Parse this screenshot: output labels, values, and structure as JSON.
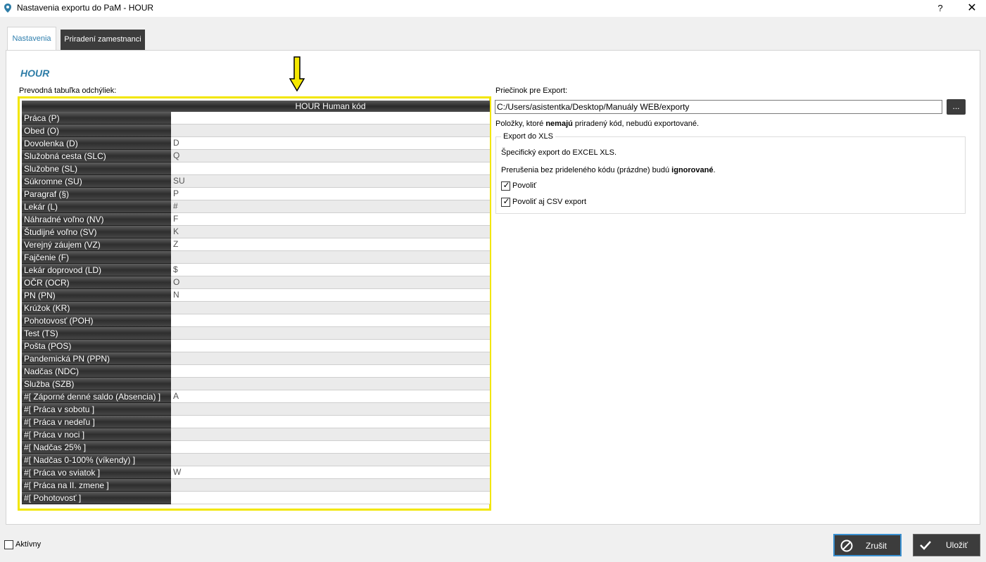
{
  "window": {
    "title": "Nastavenia exportu do PaM - HOUR",
    "help": "?",
    "close": "✕"
  },
  "tabs": [
    {
      "label": "Nastavenia",
      "active": true
    },
    {
      "label": "Priradení zamestnanci",
      "active": false
    }
  ],
  "section_title": "HOUR",
  "table": {
    "label": "Prevodná tabuľka odchýliek:",
    "column_header": "HOUR Human kód",
    "rows": [
      {
        "name": "Práca  (P)",
        "code": ""
      },
      {
        "name": "Obed  (O)",
        "code": ""
      },
      {
        "name": "Dovolenka  (D)",
        "code": "D"
      },
      {
        "name": "Služobná cesta  (SLC)",
        "code": "Q"
      },
      {
        "name": "Služobne  (SL)",
        "code": ""
      },
      {
        "name": "Súkromne  (SU)",
        "code": "SU"
      },
      {
        "name": "Paragraf  (§)",
        "code": "P"
      },
      {
        "name": "Lekár  (L)",
        "code": "#"
      },
      {
        "name": "Náhradné voľno  (NV)",
        "code": "F"
      },
      {
        "name": "Študijné voľno  (SV)",
        "code": "K"
      },
      {
        "name": "Verejný záujem  (VZ)",
        "code": "Z"
      },
      {
        "name": "Fajčenie  (F)",
        "code": ""
      },
      {
        "name": "Lekár doprovod  (LD)",
        "code": "$"
      },
      {
        "name": "OČR  (OCR)",
        "code": "O"
      },
      {
        "name": "PN  (PN)",
        "code": "N"
      },
      {
        "name": "Krúžok  (KR)",
        "code": ""
      },
      {
        "name": "Pohotovosť  (POH)",
        "code": ""
      },
      {
        "name": "Test  (TS)",
        "code": ""
      },
      {
        "name": "Pošta  (POS)",
        "code": ""
      },
      {
        "name": "Pandemická PN  (PPN)",
        "code": ""
      },
      {
        "name": "Nadčas  (NDC)",
        "code": ""
      },
      {
        "name": "Služba  (SZB)",
        "code": ""
      },
      {
        "name": " #[ Záporné denné saldo (Absencia) ]",
        "code": "A"
      },
      {
        "name": " #[ Práca v sobotu ]",
        "code": ""
      },
      {
        "name": " #[ Práca v nedeľu ]",
        "code": ""
      },
      {
        "name": " #[ Práca v noci ]",
        "code": ""
      },
      {
        "name": " #[ Nadčas 25% ]",
        "code": ""
      },
      {
        "name": " #[ Nadčas 0-100% (víkendy) ]",
        "code": ""
      },
      {
        "name": " #[ Práca vo sviatok ]",
        "code": "W"
      },
      {
        "name": " #[ Práca na II. zmene ]",
        "code": ""
      },
      {
        "name": " #[ Pohotovosť ]",
        "code": ""
      }
    ]
  },
  "export": {
    "label": "Priečinok pre Export:",
    "path": "C:/Users/asistentka/Desktop/Manuály WEB/exporty",
    "browse": "...",
    "info_pre": "Položky, ktoré ",
    "info_bold": "nemajú",
    "info_post": " priradený kód, nebudú exportované."
  },
  "xls": {
    "legend": "Export do XLS",
    "spec": "Špecifický export do EXCEL XLS.",
    "break_pre": "Prerušenia bez prideleného kódu (prázdne) budú ",
    "break_bold": "ignorované",
    "break_post": ".",
    "enable_label": "Povoliť",
    "enable_checked": true,
    "csv_label": "Povoliť aj  CSV export",
    "csv_checked": true
  },
  "footer": {
    "active_label": "Aktívny",
    "active_checked": false,
    "cancel_label": "Zrušit",
    "save_label": "Uložiť"
  },
  "colors": {
    "accent": "#2e7da7",
    "highlight": "#f2e600",
    "dark_button": "#3c3c3c",
    "focus_border": "#3a90d0"
  }
}
